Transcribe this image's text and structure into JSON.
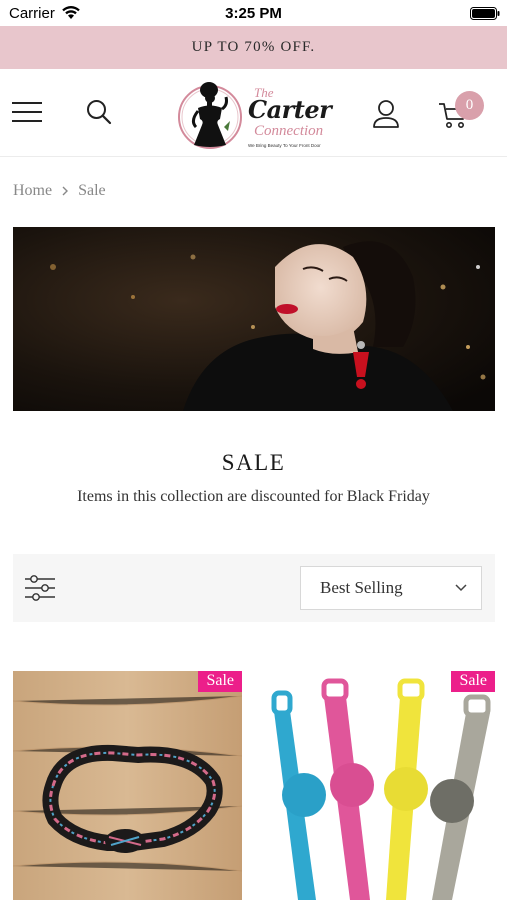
{
  "status_bar": {
    "carrier": "Carrier",
    "time": "3:25 PM"
  },
  "promo": {
    "text": "UP TO 70% OFF."
  },
  "header": {
    "logo": {
      "line1": "The",
      "line2": "Carter",
      "line3": "Connection",
      "tagline": "We Bring Beauty To Your Front Door"
    },
    "cart_count": "0",
    "icons": [
      "menu-icon",
      "search-icon",
      "account-icon",
      "cart-icon"
    ]
  },
  "breadcrumb": {
    "home": "Home",
    "current": "Sale"
  },
  "collection": {
    "title": "SALE",
    "description": "Items in this collection are discounted for Black Friday"
  },
  "toolbar": {
    "sort_value": "Best Selling"
  },
  "products": [
    {
      "badge": "Sale"
    },
    {
      "badge": "Sale"
    }
  ],
  "colors": {
    "promo_bg": "#e8c6cc",
    "cart_badge": "#d9a0ab",
    "sale_badge": "#ec1f8a",
    "logo_pink": "#d38a9b"
  }
}
